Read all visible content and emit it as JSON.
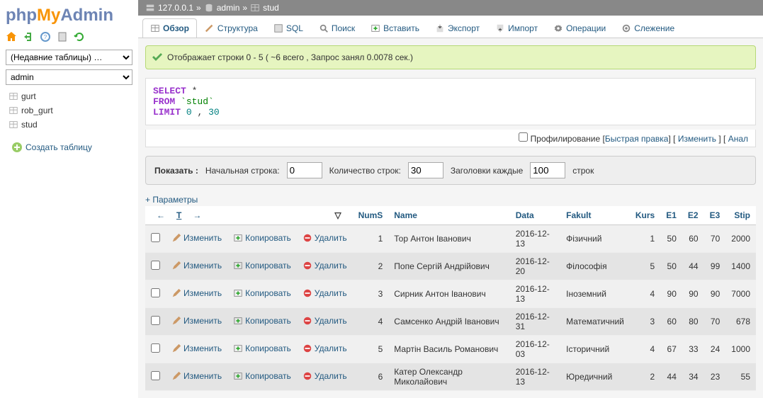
{
  "logo": {
    "p1": "php",
    "p2": "My",
    "p3": "Admin"
  },
  "recent_select": "(Недавние таблицы) …",
  "db_select": "admin",
  "tree": [
    "gurt",
    "rob_gurt",
    "stud"
  ],
  "create_table": "Создать таблицу",
  "breadcrumb": {
    "host": "127.0.0.1",
    "db": "admin",
    "table": "stud",
    "sep": "»"
  },
  "tabs": [
    "Обзор",
    "Структура",
    "SQL",
    "Поиск",
    "Вставить",
    "Экспорт",
    "Импорт",
    "Операции",
    "Слежение"
  ],
  "success_msg": "Отображает строки 0 - 5  ( ~6 всего  ,  Запрос занял 0.0078 сек.)",
  "sql": {
    "select": "SELECT",
    "star": "*",
    "from": "FROM",
    "table": "`stud`",
    "limit": "LIMIT",
    "n1": "0",
    "comma": ",",
    "n2": "30"
  },
  "actions": {
    "profiling": "Профилирование",
    "lb": "[",
    "rb": "]",
    "quick_edit": "Быстрая правка",
    "edit": "Изменить",
    "analyze": "Анал"
  },
  "showbar": {
    "show": "Показать :",
    "start": "Начальная строка:",
    "start_val": "0",
    "count": "Количество строк:",
    "count_val": "30",
    "headers": "Заголовки каждые",
    "headers_val": "100",
    "rows": "строк"
  },
  "params": "+ Параметры",
  "row_actions": {
    "edit": "Изменить",
    "copy": "Копировать",
    "delete": "Удалить"
  },
  "columns": [
    "NumS",
    "Name",
    "Data",
    "Fakult",
    "Kurs",
    "E1",
    "E2",
    "E3",
    "Stip"
  ],
  "rows": [
    {
      "NumS": "1",
      "Name": "Тор Антон Іванович",
      "Data": "2016-12-13",
      "Fakult": "Фізичний",
      "Kurs": "1",
      "E1": "50",
      "E2": "60",
      "E3": "70",
      "Stip": "2000"
    },
    {
      "NumS": "2",
      "Name": "Попе Сергій Андрійович",
      "Data": "2016-12-20",
      "Fakult": "Філософія",
      "Kurs": "5",
      "E1": "50",
      "E2": "44",
      "E3": "99",
      "Stip": "1400"
    },
    {
      "NumS": "3",
      "Name": "Сирник Антон Іванович",
      "Data": "2016-12-13",
      "Fakult": "Іноземний",
      "Kurs": "4",
      "E1": "90",
      "E2": "90",
      "E3": "90",
      "Stip": "7000"
    },
    {
      "NumS": "4",
      "Name": "Самсенко Андрій Іванович",
      "Data": "2016-12-31",
      "Fakult": "Математичний",
      "Kurs": "3",
      "E1": "60",
      "E2": "80",
      "E3": "70",
      "Stip": "678"
    },
    {
      "NumS": "5",
      "Name": "Мартін Василь Романович",
      "Data": "2016-12-03",
      "Fakult": "Історичний",
      "Kurs": "4",
      "E1": "67",
      "E2": "33",
      "E3": "24",
      "Stip": "1000"
    },
    {
      "NumS": "6",
      "Name": "Катер Олександр Миколайович",
      "Data": "2016-12-13",
      "Fakult": "Юредичний",
      "Kurs": "2",
      "E1": "44",
      "E2": "34",
      "E3": "23",
      "Stip": "55"
    }
  ]
}
